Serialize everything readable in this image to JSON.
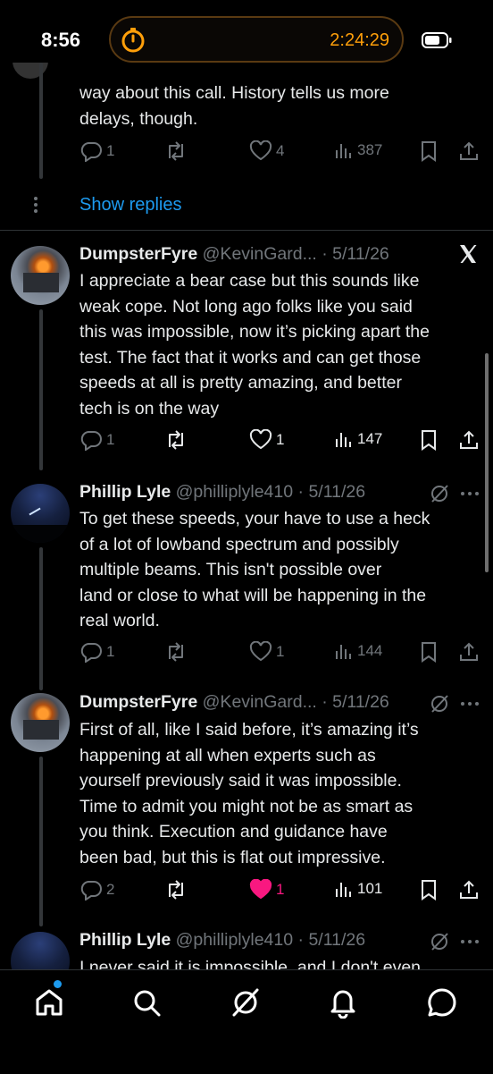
{
  "status_bar": {
    "time": "8:56",
    "timer": "2:24:29"
  },
  "top_tweet": {
    "text_lines": [
      "way about this call.   History tells us more",
      "delays, though."
    ],
    "replies": "1",
    "reposts": "",
    "likes": "4",
    "views": "387"
  },
  "show_replies": "Show replies",
  "tweets": [
    {
      "name": "DumpsterFyre",
      "handle": "@KevinGard...",
      "date": "· 5/11/26",
      "text_lines": [
        "I appreciate a bear case but this sounds like",
        "weak cope. Not long ago folks like you said",
        "this was impossible, now it’s picking apart the",
        "test. The fact that it works and can get those",
        "speeds at all is pretty amazing, and better",
        "tech is on the way"
      ],
      "replies": "1",
      "reposts": "",
      "likes": "1",
      "views": "147"
    },
    {
      "name": "Phillip Lyle",
      "handle": "@philliplyle410",
      "date": "· 5/11/26",
      "text_lines": [
        "To get these speeds, your have to use a heck",
        "of a lot of lowband spectrum and possibly",
        "multiple beams.   This isn't possible over",
        "land or close to what will be happening in the",
        "real world."
      ],
      "replies": "1",
      "reposts": "",
      "likes": "1",
      "views": "144"
    },
    {
      "name": "DumpsterFyre",
      "handle": "@KevinGard...",
      "date": "· 5/11/26",
      "text_lines": [
        "First of all, like I said before, it’s amazing it’s",
        "happening at all when experts such as",
        "yourself previously said it was impossible.",
        "Time to admit you might not be as smart as",
        "you think. Execution and guidance have",
        "been bad, but this is flat out impressive."
      ],
      "replies": "2",
      "reposts": "",
      "likes": "1",
      "views": "101"
    },
    {
      "name": "Phillip Lyle",
      "handle": "@philliplyle410",
      "date": "· 5/11/26",
      "text_lines": [
        "I never said it is impossible, and I don't even"
      ]
    }
  ],
  "colors": {
    "accent": "#1d9bf0",
    "like_active": "#f91880",
    "timer": "#ff9f0a"
  }
}
